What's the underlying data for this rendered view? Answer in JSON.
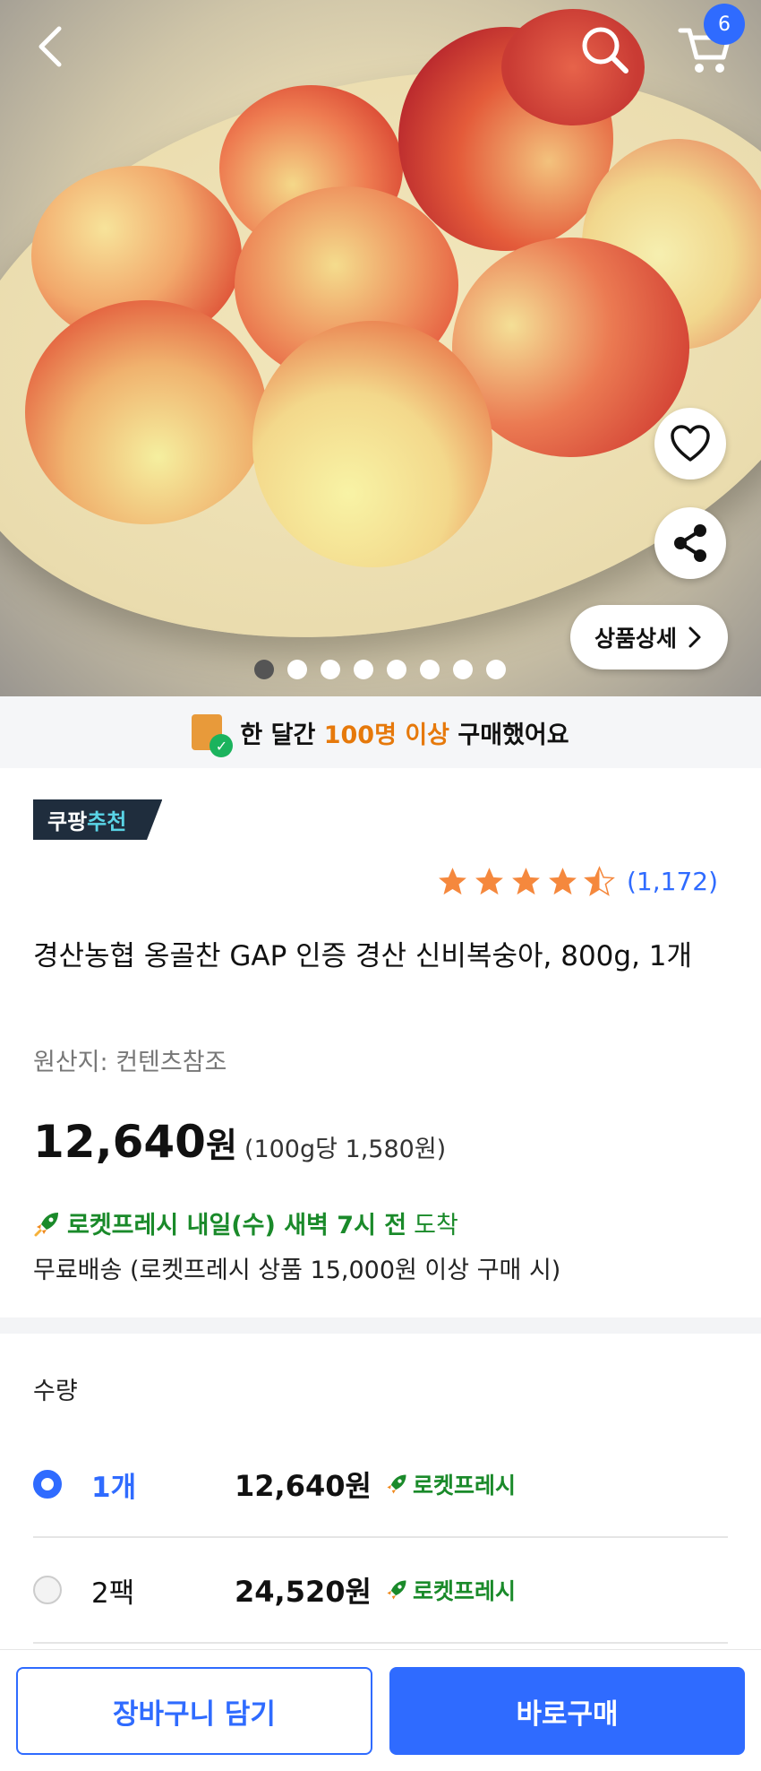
{
  "header": {
    "cart_count": "6",
    "detail_button_label": "상품상세",
    "image_count": 8,
    "active_image_index": 1
  },
  "purchase_banner": {
    "prefix": "한 달간",
    "highlight": "100명 이상",
    "suffix": "구매했어요"
  },
  "recommend_badge": {
    "brand": "쿠팡",
    "accent": "추천"
  },
  "rating": {
    "stars": 4.5,
    "review_count": "(1,172)"
  },
  "product": {
    "title": "경산농협 옹골찬 GAP 인증 경산 신비복숭아, 800g, 1개",
    "origin": "원산지: 컨텐츠참조",
    "price": "12,640",
    "price_unit": "원",
    "unit_price": "(100g당 1,580원)"
  },
  "delivery": {
    "rocket_text": "로켓프레시 내일(수) 새벽 7시 전",
    "arrive": "도착",
    "free_shipping": "무료배송 (로켓프레시 상품 15,000원 이상 구매 시)"
  },
  "quantity": {
    "label": "수량",
    "options": [
      {
        "name": "1개",
        "price": "12,640원",
        "tag": "로켓프레시",
        "selected": true
      },
      {
        "name": "2팩",
        "price": "24,520원",
        "tag": "로켓프레시",
        "selected": false
      }
    ]
  },
  "actions": {
    "add_to_cart": "장바구니 담기",
    "buy_now": "바로구매"
  },
  "colors": {
    "accent": "#2f6bff",
    "rocket_green": "#1a8a2a",
    "highlight_orange": "#e6790b",
    "star": "#f5883d"
  }
}
